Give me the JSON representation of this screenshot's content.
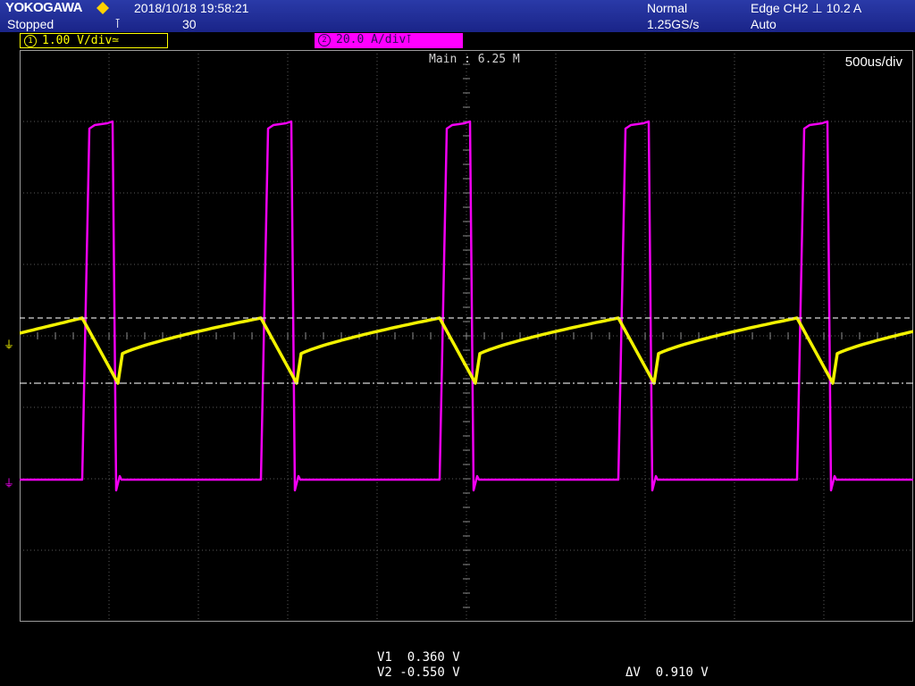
{
  "header": {
    "brand": "YOKOGAWA",
    "state": "Stopped",
    "datetime": "2018/10/18 19:58:21",
    "trigger_icon": "⊺",
    "acq_count": "30",
    "trigger_mode": "Normal",
    "sample_rate": "1.25GS/s",
    "trigger_desc": "Edge CH2 ⊥ 10.2 A",
    "trigger_sweep": "Auto"
  },
  "channels": [
    {
      "number": "1",
      "scale": "1.00 V/div",
      "coupling_icon": "≃",
      "color": "#ffff00"
    },
    {
      "number": "2",
      "scale": "20.0 A/div",
      "coupling_icon": "⊺",
      "color": "#ff00ff"
    }
  ],
  "display": {
    "main_label": "Main : 6.25 M",
    "time_div": "500us/div",
    "grid_divisions": {
      "horizontal": 10,
      "vertical": 8
    }
  },
  "cursors": {
    "v1": "V1  0.360 V",
    "v2": "V2 -0.550 V",
    "dv": "ΔV  0.910 V"
  },
  "colors": {
    "header_bg": "#1f2c9a",
    "ch1": "#ffff00",
    "ch2": "#ff00ff",
    "grid": "#5a5a5a",
    "background": "#000000"
  }
}
